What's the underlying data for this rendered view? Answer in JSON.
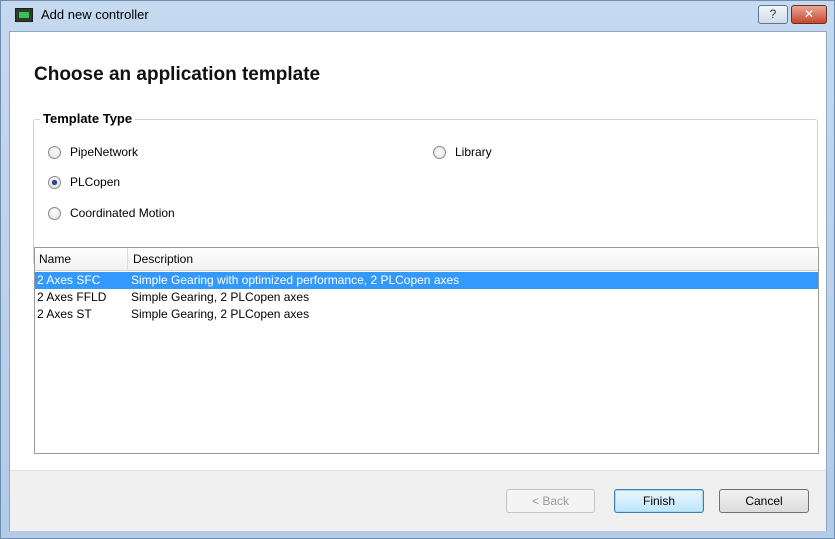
{
  "window": {
    "title": "Add new controller",
    "help_label": "?",
    "close_label": "✕"
  },
  "page": {
    "heading": "Choose an application template"
  },
  "template_type": {
    "label": "Template Type",
    "options": [
      {
        "label": "PipeNetwork",
        "checked": false
      },
      {
        "label": "Library",
        "checked": false
      },
      {
        "label": "PLCopen",
        "checked": true
      },
      {
        "label": "Coordinated Motion",
        "checked": false
      }
    ]
  },
  "templates": {
    "columns": [
      "Name",
      "Description"
    ],
    "rows": [
      {
        "name": "2 Axes SFC",
        "description": "Simple Gearing with optimized performance, 2 PLCopen axes",
        "selected": true
      },
      {
        "name": "2 Axes FFLD",
        "description": "Simple Gearing, 2 PLCopen axes",
        "selected": false
      },
      {
        "name": "2 Axes ST",
        "description": "Simple Gearing, 2 PLCopen axes",
        "selected": false
      }
    ]
  },
  "buttons": {
    "back": "< Back",
    "finish": "Finish",
    "cancel": "Cancel"
  },
  "colors": {
    "selection": "#3399ff",
    "title_gradient": "#b2cbe6",
    "close": "#c6462c"
  }
}
